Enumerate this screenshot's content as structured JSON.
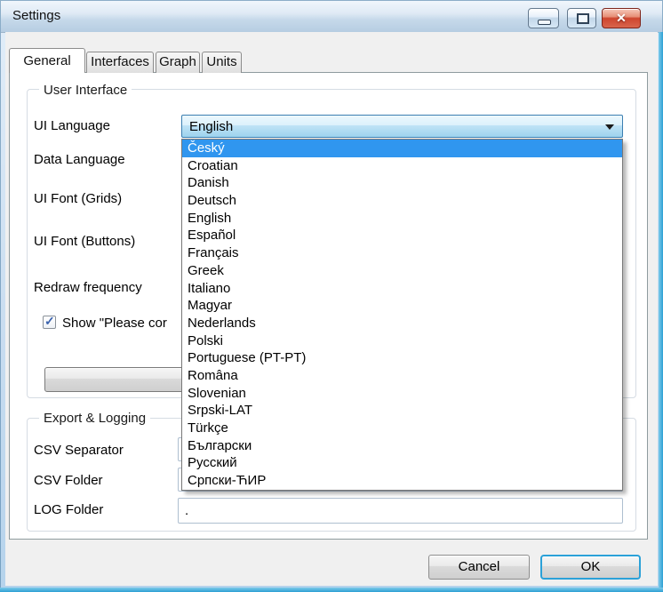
{
  "colors": {
    "selection_highlight": "#3096ef",
    "close_button_red": "#ce452e",
    "frame_accent": "#2d9fd4",
    "combo_border": "#3c7fb1"
  },
  "window": {
    "title": "Settings"
  },
  "tabs": [
    {
      "label": "General",
      "active": true
    },
    {
      "label": "Interfaces",
      "active": false
    },
    {
      "label": "Graph",
      "active": false
    },
    {
      "label": "Units",
      "active": false
    }
  ],
  "general_tab": {
    "user_interface_group": {
      "title": "User Interface",
      "labels": {
        "ui_language": "UI Language",
        "data_language": "Data Language",
        "ui_font_grids": "UI Font (Grids)",
        "ui_font_buttons": "UI Font (Buttons)",
        "redraw_frequency": "Redraw frequency"
      },
      "ui_language_combo": {
        "value": "English",
        "expanded": true
      },
      "show_please_checkbox": {
        "label_visible": "Show \"Please cor",
        "checked": true
      }
    },
    "language_dropdown": {
      "highlighted_index": 0,
      "items": [
        "Český",
        "Croatian",
        "Danish",
        "Deutsch",
        "English",
        "Español",
        "Français",
        "Greek",
        "Italiano",
        "Magyar",
        "Nederlands",
        "Polski",
        "Portuguese (PT-PT)",
        "Româna",
        "Slovenian",
        "Srpski-LAT",
        "Türkçe",
        "Български",
        "Русский",
        "Српски-ЋИР"
      ]
    },
    "export_logging_group": {
      "title": "Export & Logging",
      "labels": {
        "csv_separator": "CSV Separator",
        "csv_folder": "CSV Folder",
        "log_folder": "LOG Folder"
      },
      "csv_separator_value": "",
      "csv_folder_value": "",
      "log_folder_value": "."
    }
  },
  "footer": {
    "cancel_label": "Cancel",
    "ok_label": "OK"
  }
}
